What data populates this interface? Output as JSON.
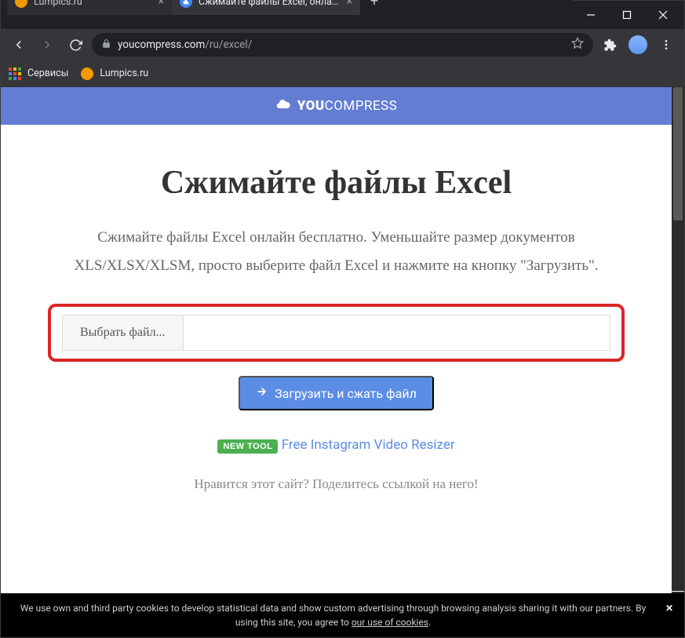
{
  "window": {
    "tabs": [
      {
        "title": "Lumpics.ru",
        "active": false
      },
      {
        "title": "Сжимайте файлы Excel, онлайн",
        "active": true
      }
    ],
    "url_host": "youcompress.com",
    "url_path": "/ru/excel/"
  },
  "bookmarks": {
    "apps": "Сервисы",
    "items": [
      {
        "label": "Lumpics.ru"
      }
    ]
  },
  "site": {
    "brand_prefix": "YOU",
    "brand_suffix": "COMPRESS",
    "heading": "Сжимайте файлы Excel",
    "description": "Сжимайте файлы Excel онлайн бесплатно. Уменьшайте размер документов XLS/XLSX/XLSM, просто выберите файл Excel и нажмите на кнопку \"Загрузить\".",
    "choose_file": "Выбрать файл...",
    "upload_button": "Загрузить и сжать файл",
    "new_tool_badge": "NEW TOOL",
    "new_tool_link": "Free Instagram Video Resizer",
    "share_text": "Нравится этот сайт? Поделитесь ссылкой на него!"
  },
  "cookie": {
    "text_before": "We use own and third party cookies to develop statistical data and show custom advertising through browsing analysis sharing it with our partners. By using this site, you agree to ",
    "link": "our use of cookies",
    "text_after": "."
  }
}
